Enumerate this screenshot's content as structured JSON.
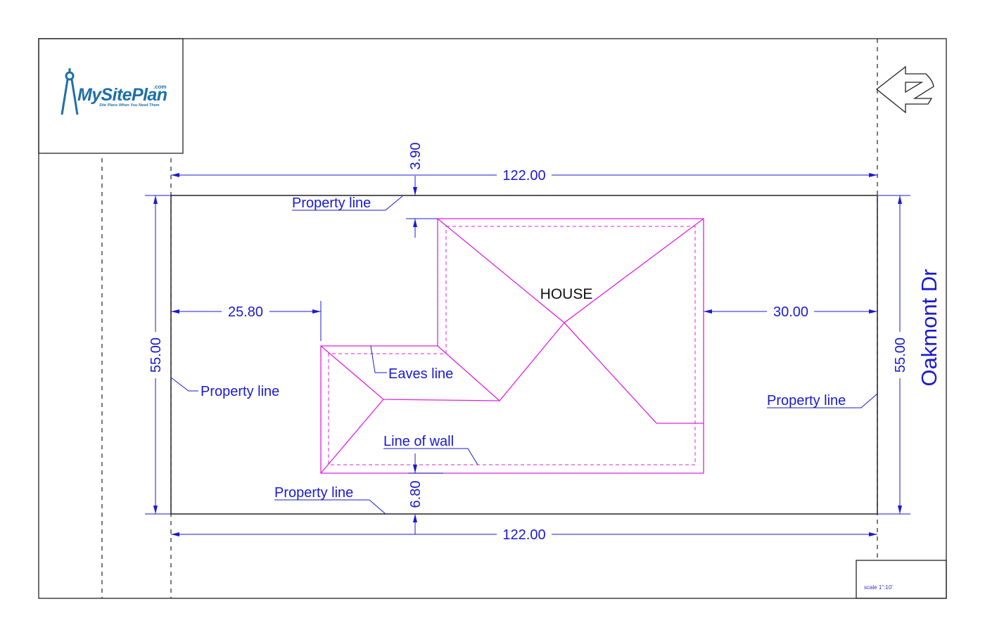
{
  "logo": {
    "brand": "MySitePlan",
    "suffix": ".com",
    "tagline": "Site Plans When You Need Them"
  },
  "street_name": "Oakmont Dr",
  "scale_text": "scale 1\":10'",
  "house_label": "HOUSE",
  "dimensions": {
    "top_width": "122.00",
    "bottom_width": "122.00",
    "left_depth": "55.00",
    "right_depth": "55.00",
    "front_setback_top": "3.90",
    "left_setback": "25.80",
    "right_setback": "30.00",
    "bottom_setback": "6.80"
  },
  "labels": {
    "property_line_top": "Property line",
    "property_line_left": "Property line",
    "property_line_right": "Property line",
    "property_line_bottom": "Property line",
    "eaves_line": "Eaves line",
    "line_of_wall": "Line of wall"
  },
  "colors": {
    "dimension": "#1a1ad0",
    "roof": "#e020e0",
    "border": "#222222",
    "logo": "#1f6fa8"
  },
  "icons": [
    "north-arrow-icon",
    "compass-logo-icon"
  ]
}
